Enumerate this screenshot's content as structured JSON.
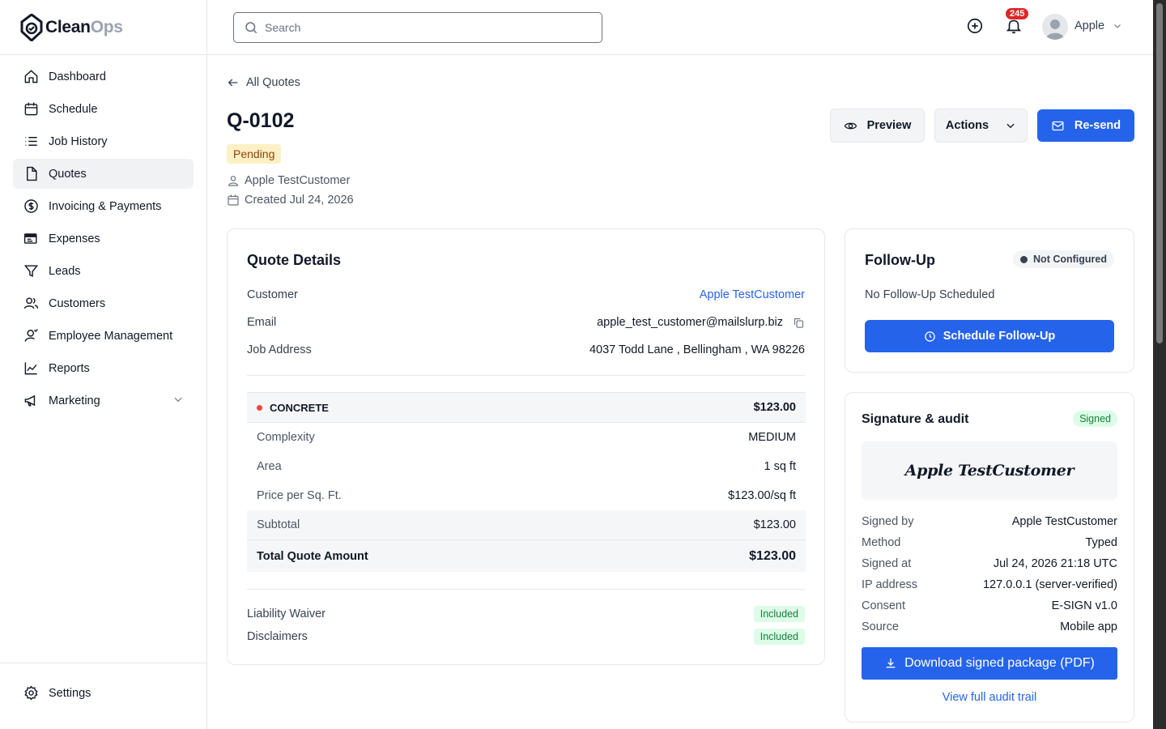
{
  "app": {
    "brand_left": "Clean",
    "brand_right": "Ops"
  },
  "sidebar": {
    "items": [
      {
        "label": "Dashboard",
        "icon": "home-icon"
      },
      {
        "label": "Schedule",
        "icon": "calendar-icon"
      },
      {
        "label": "Job History",
        "icon": "list-icon"
      },
      {
        "label": "Quotes",
        "icon": "document-icon",
        "active": true
      },
      {
        "label": "Invoicing & Payments",
        "icon": "dollar-icon"
      },
      {
        "label": "Expenses",
        "icon": "receipt-icon"
      },
      {
        "label": "Leads",
        "icon": "filter-icon"
      },
      {
        "label": "Customers",
        "icon": "users-icon"
      },
      {
        "label": "Employee Management",
        "icon": "user-cog-icon"
      },
      {
        "label": "Reports",
        "icon": "chart-line-icon"
      },
      {
        "label": "Marketing",
        "icon": "megaphone-icon"
      }
    ],
    "settings_label": "Settings"
  },
  "header": {
    "search_placeholder": "Search",
    "notification_count": "245",
    "user_name": "Apple"
  },
  "page": {
    "back_label": "All Quotes",
    "quote_number": "Q-0102",
    "status": "Pending",
    "customer_name": "Apple TestCustomer",
    "created": "Created Jul 24, 2026",
    "buttons": {
      "preview": "Preview",
      "actions": "Actions",
      "resend": "Re-send"
    }
  },
  "quote_details": {
    "title": "Quote Details",
    "customer_label": "Customer",
    "customer_value": "Apple TestCustomer",
    "email_label": "Email",
    "email_value": "apple_test_customer@mailslurp.biz",
    "address_label": "Job Address",
    "address_value": "4037 Todd Lane , Bellingham , WA 98226",
    "line_item": {
      "name": "CONCRETE",
      "price": "$123.00",
      "rows": [
        {
          "label": "Complexity",
          "value": "MEDIUM"
        },
        {
          "label": "Area",
          "value": "1 sq ft"
        },
        {
          "label": "Price per Sq. Ft.",
          "value": "$123.00/sq ft"
        }
      ],
      "subtotal_label": "Subtotal",
      "subtotal_value": "$123.00",
      "total_label": "Total Quote Amount",
      "total_value": "$123.00"
    },
    "waiver_label": "Liability Waiver",
    "waiver_status": "Included",
    "disclaimers_label": "Disclaimers",
    "disclaimers_status": "Included"
  },
  "follow_up": {
    "title": "Follow-Up",
    "status": "Not Configured",
    "message": "No Follow-Up Scheduled",
    "button": "Schedule Follow-Up"
  },
  "signature": {
    "title": "Signature & audit",
    "status": "Signed",
    "signature_text": "Apple TestCustomer",
    "fields": [
      {
        "label": "Signed by",
        "value": "Apple TestCustomer"
      },
      {
        "label": "Method",
        "value": "Typed"
      },
      {
        "label": "Signed at",
        "value": "Jul 24, 2026 21:18 UTC"
      },
      {
        "label": "IP address",
        "value": "127.0.0.1 (server-verified)"
      },
      {
        "label": "Consent",
        "value": "E-SIGN v1.0"
      },
      {
        "label": "Source",
        "value": "Mobile app"
      }
    ],
    "download_button": "Download signed package (PDF)",
    "audit_link": "View full audit trail"
  },
  "colors": {
    "accent": "#2563eb",
    "pending_bg": "#fdf0c4",
    "success_bg": "#dcfce7",
    "danger": "#dc2626"
  }
}
